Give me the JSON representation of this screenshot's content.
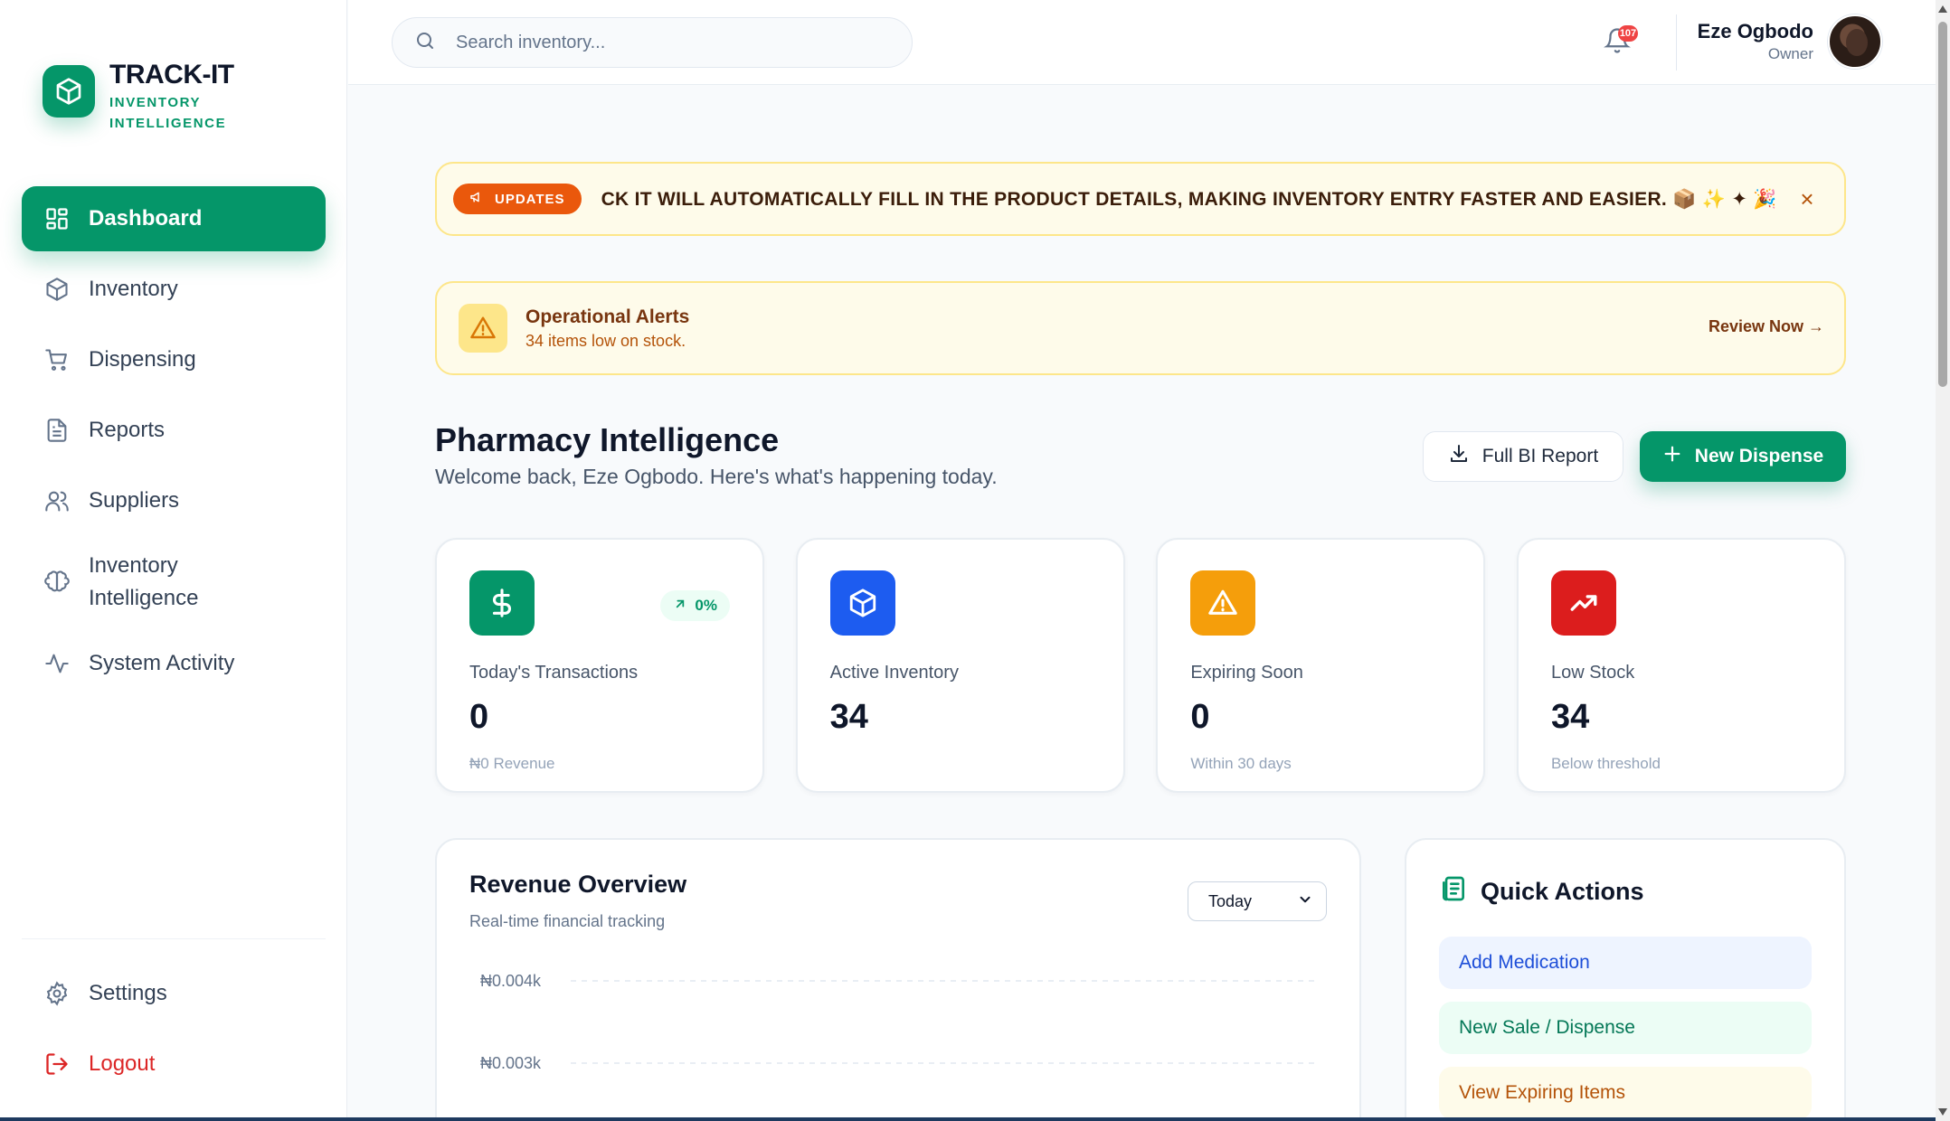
{
  "brand": {
    "title": "TRACK-IT",
    "subtitle": "INVENTORY INTELLIGENCE",
    "accent": "#059669"
  },
  "sidebar": {
    "items": [
      {
        "label": "Dashboard",
        "icon": "grid-icon",
        "active": true
      },
      {
        "label": "Inventory",
        "icon": "box-icon"
      },
      {
        "label": "Dispensing",
        "icon": "cart-icon"
      },
      {
        "label": "Reports",
        "icon": "file-icon"
      },
      {
        "label": "Suppliers",
        "icon": "users-icon"
      },
      {
        "label": "Inventory Intelligence",
        "icon": "brain-icon"
      },
      {
        "label": "System Activity",
        "icon": "activity-icon"
      }
    ],
    "bottom": [
      {
        "label": "Settings",
        "icon": "gear-icon"
      },
      {
        "label": "Logout",
        "icon": "logout-icon",
        "color": "#dc2626"
      }
    ]
  },
  "topbar": {
    "search_placeholder": "Search inventory...",
    "notification_count": "107",
    "user_name": "Eze Ogbodo",
    "user_role": "Owner"
  },
  "updates": {
    "badge": "UPDATES",
    "text": "CK IT WILL AUTOMATICALLY FILL IN THE PRODUCT DETAILS, MAKING INVENTORY ENTRY FASTER AND EASIER. 📦 ✨ ✦ 🎉 HA",
    "close": "×"
  },
  "alert": {
    "title": "Operational Alerts",
    "subtitle": "34 items low on stock.",
    "action": "Review Now →"
  },
  "heading": {
    "title": "Pharmacy Intelligence",
    "subtitle": "Welcome back, Eze Ogbodo. Here's what's happening today.",
    "report_button": "Full BI Report",
    "dispense_button": "New Dispense"
  },
  "stats": [
    {
      "label": "Today's Transactions",
      "value": "0",
      "note": "₦0 Revenue",
      "trend": "0%",
      "icon": "dollar-icon",
      "color": "#059669"
    },
    {
      "label": "Active Inventory",
      "value": "34",
      "note": "",
      "icon": "box-icon",
      "color": "#1d5cf0"
    },
    {
      "label": "Expiring Soon",
      "value": "0",
      "note": "Within 30 days",
      "icon": "warning-icon",
      "color": "#f59e0b"
    },
    {
      "label": "Low Stock",
      "value": "34",
      "note": "Below threshold",
      "icon": "trending-up-icon",
      "color": "#dc1d1d"
    }
  ],
  "revenue": {
    "title": "Revenue Overview",
    "subtitle": "Real-time financial tracking",
    "period": "Today",
    "y_ticks": [
      "₦0.004k",
      "₦0.003k"
    ]
  },
  "quick_actions": {
    "title": "Quick Actions",
    "items": [
      {
        "label": "Add Medication",
        "style": "blue"
      },
      {
        "label": "New Sale / Dispense",
        "style": "green"
      },
      {
        "label": "View Expiring Items",
        "style": "amber"
      }
    ]
  }
}
